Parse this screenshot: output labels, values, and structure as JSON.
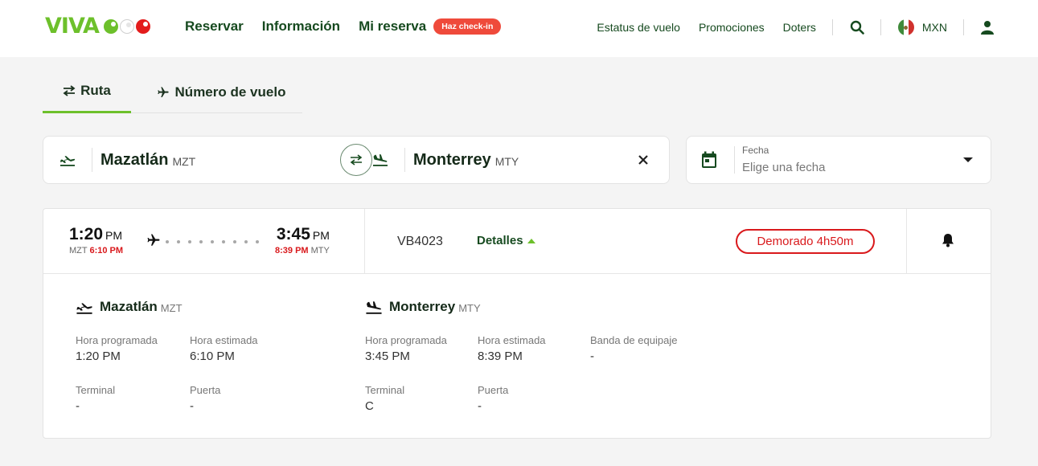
{
  "brand": {
    "logo_text": "VIVA"
  },
  "header": {
    "nav": [
      "Reservar",
      "Información",
      "Mi reserva"
    ],
    "checkin_badge": "Haz check-in",
    "right_links": [
      "Estatus de vuelo",
      "Promociones",
      "Doters"
    ],
    "currency": "MXN"
  },
  "tabs": [
    {
      "label": "Ruta",
      "active": true
    },
    {
      "label": "Número de vuelo",
      "active": false
    }
  ],
  "search": {
    "origin_city": "Mazatlán",
    "origin_code": "MZT",
    "dest_city": "Monterrey",
    "dest_code": "MTY",
    "date_label": "Fecha",
    "date_placeholder": "Elige una fecha"
  },
  "result": {
    "dep_time": "1:20",
    "dep_ampm": "PM",
    "dep_code": "MZT",
    "dep_new_time": "6:10 PM",
    "arr_time": "3:45",
    "arr_ampm": "PM",
    "arr_new_time": "8:39 PM",
    "arr_code": "MTY",
    "flight_number": "VB4023",
    "details_label": "Detalles",
    "status": "Demorado 4h50m",
    "origin": {
      "city": "Mazatlán",
      "code": "MZT",
      "scheduled_label": "Hora programada",
      "scheduled": "1:20 PM",
      "estimated_label": "Hora estimada",
      "estimated": "6:10 PM",
      "terminal_label": "Terminal",
      "terminal": "-",
      "gate_label": "Puerta",
      "gate": "-"
    },
    "destination": {
      "city": "Monterrey",
      "code": "MTY",
      "scheduled_label": "Hora programada",
      "scheduled": "3:45 PM",
      "estimated_label": "Hora estimada",
      "estimated": "8:39 PM",
      "baggage_label": "Banda de equipaje",
      "baggage": "-",
      "terminal_label": "Terminal",
      "terminal": "C",
      "gate_label": "Puerta",
      "gate": "-"
    }
  },
  "colors": {
    "brand_green": "#6dc02b",
    "dark_green": "#164a1f",
    "alert_red": "#d9191c"
  }
}
